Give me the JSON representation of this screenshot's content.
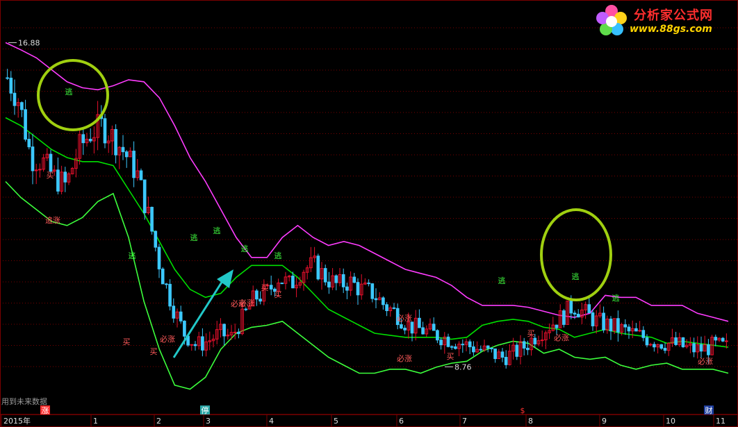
{
  "logo": {
    "title": "分析家公式网",
    "url": "www.88gs.com"
  },
  "note": "用到未来数据",
  "colors": {
    "background": "#000000",
    "grid": "#7a0000",
    "up_candle": "#e8102c",
    "down_candle": "#3cc8ff",
    "upper_band": "#ff3cff",
    "middle_band": "#00e000",
    "lower_band": "#3cff3c",
    "circle": "#a0d010",
    "arrow": "#22c8c8",
    "buy_text": "#ff5a5a",
    "escape_text": "#40ff40",
    "axis_text": "#e0e0e0"
  },
  "chart_data": {
    "type": "candlestick",
    "title": "",
    "ylim": [
      7.6,
      17.6
    ],
    "max_label": "16.88",
    "min_label": "8.76",
    "x_ticks": [
      "2015年",
      "1",
      "2",
      "3",
      "4",
      "5",
      "6",
      "7",
      "8",
      "9",
      "10",
      "11"
    ],
    "bottom_markers": [
      "涨",
      "停",
      "$",
      "财"
    ],
    "signals": [
      {
        "text": "逃",
        "kind": "escape",
        "index": 15
      },
      {
        "text": "买",
        "kind": "buy",
        "index": 11
      },
      {
        "text": "追涨",
        "kind": "buy",
        "index": 11
      },
      {
        "text": "逃",
        "kind": "escape",
        "index": 36
      },
      {
        "text": "买",
        "kind": "buy",
        "index": 33
      },
      {
        "text": "买",
        "kind": "buy",
        "index": 40
      },
      {
        "text": "必涨",
        "kind": "buy",
        "index": 42
      },
      {
        "text": "逃",
        "kind": "escape",
        "index": 49
      },
      {
        "text": "逃",
        "kind": "escape",
        "index": 54
      },
      {
        "text": "逃",
        "kind": "escape",
        "index": 62
      },
      {
        "text": "必涨",
        "kind": "buy",
        "index": 66
      },
      {
        "text": "逃",
        "kind": "escape",
        "index": 70
      },
      {
        "text": "买",
        "kind": "buy",
        "index": 60
      },
      {
        "text": "买",
        "kind": "buy",
        "index": 63
      },
      {
        "text": "必涨",
        "kind": "buy",
        "index": 72
      },
      {
        "text": "逃",
        "kind": "escape",
        "index": 106
      },
      {
        "text": "必涨",
        "kind": "buy",
        "index": 102
      },
      {
        "text": "买",
        "kind": "buy",
        "index": 114
      },
      {
        "text": "逃",
        "kind": "escape",
        "index": 136
      },
      {
        "text": "买",
        "kind": "buy",
        "index": 134
      },
      {
        "text": "必涨",
        "kind": "buy",
        "index": 148
      },
      {
        "text": "逃",
        "kind": "escape",
        "index": 154
      },
      {
        "text": "必涨",
        "kind": "buy",
        "index": 155
      },
      {
        "text": "必涨",
        "kind": "buy",
        "index": 185
      }
    ],
    "upper_band": [
      16.88,
      16.7,
      16.5,
      16.2,
      15.9,
      15.75,
      15.7,
      15.8,
      15.95,
      15.9,
      15.5,
      14.8,
      14.0,
      13.4,
      12.7,
      12.0,
      11.5,
      11.5,
      12.0,
      12.3,
      12.0,
      11.8,
      11.9,
      11.8,
      11.6,
      11.4,
      11.2,
      11.1,
      11.0,
      10.8,
      10.5,
      10.3,
      10.3,
      10.3,
      10.25,
      10.15,
      10.05,
      10.0,
      10.1,
      10.55,
      10.5,
      10.5,
      10.3,
      10.3,
      10.3,
      10.1,
      10.0,
      9.9
    ],
    "middle_band": [
      15.0,
      14.8,
      14.5,
      14.2,
      14.0,
      13.9,
      13.9,
      13.8,
      13.2,
      12.6,
      11.9,
      11.2,
      10.7,
      10.5,
      10.6,
      11.0,
      11.3,
      11.3,
      11.3,
      11.0,
      10.6,
      10.2,
      10.0,
      9.8,
      9.6,
      9.55,
      9.5,
      9.5,
      9.5,
      9.45,
      9.5,
      9.8,
      9.9,
      9.95,
      9.9,
      9.75,
      9.7,
      9.5,
      9.6,
      9.7,
      9.6,
      9.55,
      9.5,
      9.35,
      9.4,
      9.35,
      9.3,
      9.25
    ],
    "lower_band": [
      13.4,
      13.0,
      12.7,
      12.4,
      12.3,
      12.5,
      12.9,
      13.1,
      12.0,
      10.4,
      9.2,
      8.3,
      8.2,
      8.5,
      9.2,
      9.6,
      9.75,
      9.8,
      9.9,
      9.6,
      9.3,
      9.0,
      8.8,
      8.6,
      8.6,
      8.7,
      8.7,
      8.6,
      8.75,
      8.85,
      8.9,
      9.15,
      9.3,
      9.4,
      9.35,
      9.1,
      9.2,
      9.0,
      8.95,
      9.0,
      8.8,
      8.7,
      8.8,
      8.85,
      8.7,
      8.7,
      8.7,
      8.6
    ],
    "candles_note": "synthetic daily OHLC series follows the visible price path",
    "candle_path": [
      16.0,
      15.4,
      14.0,
      13.9,
      13.5,
      13.3,
      14.2,
      14.6,
      14.8,
      14.5,
      14.1,
      13.6,
      12.5,
      11.2,
      10.3,
      9.6,
      9.3,
      9.4,
      9.6,
      9.5,
      10.0,
      10.5,
      10.6,
      11.0,
      10.8,
      11.2,
      11.3,
      11.0,
      10.8,
      10.9,
      10.7,
      10.6,
      10.3,
      10.1,
      9.8,
      9.7,
      9.6,
      9.5,
      9.4,
      9.3,
      9.2,
      9.1,
      9.0,
      9.1,
      9.3,
      9.6,
      9.8,
      10.0,
      10.3,
      10.1,
      9.9,
      9.8,
      9.7,
      9.6,
      9.5,
      9.4,
      9.35,
      9.3,
      9.2,
      9.2,
      9.3,
      9.25
    ]
  }
}
